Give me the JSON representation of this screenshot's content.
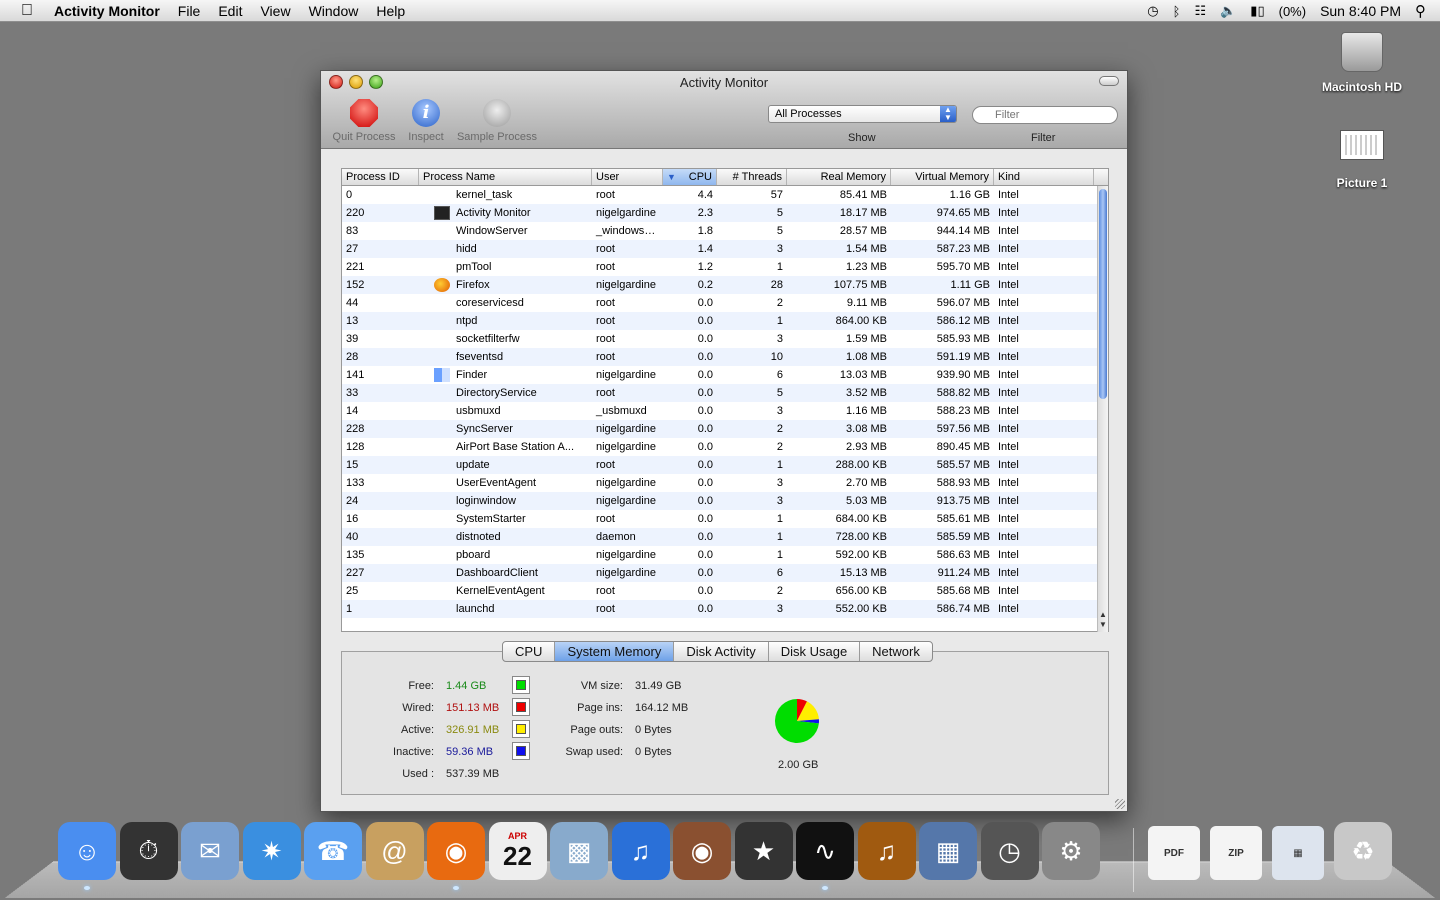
{
  "menubar": {
    "app_name": "Activity Monitor",
    "menus": [
      "File",
      "Edit",
      "View",
      "Window",
      "Help"
    ],
    "battery": "(0%)",
    "clock": "Sun 8:40 PM"
  },
  "desktop": {
    "icons": [
      {
        "label": "Macintosh HD"
      },
      {
        "label": "Picture 1"
      }
    ]
  },
  "window": {
    "title": "Activity Monitor",
    "toolbar": {
      "quit_label": "Quit Process",
      "inspect_label": "Inspect",
      "sample_label": "Sample Process",
      "inspect_glyph": "i",
      "show_value": "All Processes",
      "show_label": "Show",
      "filter_placeholder": "Filter",
      "filter_label": "Filter"
    }
  },
  "table": {
    "columns": {
      "pid": "Process ID",
      "name": "Process Name",
      "user": "User",
      "cpu": "CPU",
      "threads": "# Threads",
      "real": "Real Memory",
      "virtual": "Virtual Memory",
      "kind": "Kind"
    },
    "sorted_column": "cpu",
    "sort_direction": "descending",
    "rows": [
      {
        "pid": "0",
        "icon": "none",
        "name": "kernel_task",
        "user": "root",
        "cpu": "4.4",
        "threads": "57",
        "real": "85.41 MB",
        "virtual": "1.16 GB",
        "kind": "Intel"
      },
      {
        "pid": "220",
        "icon": "activity-monitor-icon",
        "name": "Activity Monitor",
        "user": "nigelgardine",
        "cpu": "2.3",
        "threads": "5",
        "real": "18.17 MB",
        "virtual": "974.65 MB",
        "kind": "Intel"
      },
      {
        "pid": "83",
        "icon": "none",
        "name": "WindowServer",
        "user": "_windowserv",
        "cpu": "1.8",
        "threads": "5",
        "real": "28.57 MB",
        "virtual": "944.14 MB",
        "kind": "Intel"
      },
      {
        "pid": "27",
        "icon": "none",
        "name": "hidd",
        "user": "root",
        "cpu": "1.4",
        "threads": "3",
        "real": "1.54 MB",
        "virtual": "587.23 MB",
        "kind": "Intel"
      },
      {
        "pid": "221",
        "icon": "none",
        "name": "pmTool",
        "user": "root",
        "cpu": "1.2",
        "threads": "1",
        "real": "1.23 MB",
        "virtual": "595.70 MB",
        "kind": "Intel"
      },
      {
        "pid": "152",
        "icon": "firefox-icon",
        "name": "Firefox",
        "user": "nigelgardine",
        "cpu": "0.2",
        "threads": "28",
        "real": "107.75 MB",
        "virtual": "1.11 GB",
        "kind": "Intel"
      },
      {
        "pid": "44",
        "icon": "none",
        "name": "coreservicesd",
        "user": "root",
        "cpu": "0.0",
        "threads": "2",
        "real": "9.11 MB",
        "virtual": "596.07 MB",
        "kind": "Intel"
      },
      {
        "pid": "13",
        "icon": "none",
        "name": "ntpd",
        "user": "root",
        "cpu": "0.0",
        "threads": "1",
        "real": "864.00 KB",
        "virtual": "586.12 MB",
        "kind": "Intel"
      },
      {
        "pid": "39",
        "icon": "none",
        "name": "socketfilterfw",
        "user": "root",
        "cpu": "0.0",
        "threads": "3",
        "real": "1.59 MB",
        "virtual": "585.93 MB",
        "kind": "Intel"
      },
      {
        "pid": "28",
        "icon": "none",
        "name": "fseventsd",
        "user": "root",
        "cpu": "0.0",
        "threads": "10",
        "real": "1.08 MB",
        "virtual": "591.19 MB",
        "kind": "Intel"
      },
      {
        "pid": "141",
        "icon": "finder-icon",
        "name": "Finder",
        "user": "nigelgardine",
        "cpu": "0.0",
        "threads": "6",
        "real": "13.03 MB",
        "virtual": "939.90 MB",
        "kind": "Intel"
      },
      {
        "pid": "33",
        "icon": "none",
        "name": "DirectoryService",
        "user": "root",
        "cpu": "0.0",
        "threads": "5",
        "real": "3.52 MB",
        "virtual": "588.82 MB",
        "kind": "Intel"
      },
      {
        "pid": "14",
        "icon": "none",
        "name": "usbmuxd",
        "user": "_usbmuxd",
        "cpu": "0.0",
        "threads": "3",
        "real": "1.16 MB",
        "virtual": "588.23 MB",
        "kind": "Intel"
      },
      {
        "pid": "228",
        "icon": "none",
        "name": "SyncServer",
        "user": "nigelgardine",
        "cpu": "0.0",
        "threads": "2",
        "real": "3.08 MB",
        "virtual": "597.56 MB",
        "kind": "Intel"
      },
      {
        "pid": "128",
        "icon": "none",
        "name": "AirPort Base Station A...",
        "user": "nigelgardine",
        "cpu": "0.0",
        "threads": "2",
        "real": "2.93 MB",
        "virtual": "890.45 MB",
        "kind": "Intel"
      },
      {
        "pid": "15",
        "icon": "none",
        "name": "update",
        "user": "root",
        "cpu": "0.0",
        "threads": "1",
        "real": "288.00 KB",
        "virtual": "585.57 MB",
        "kind": "Intel"
      },
      {
        "pid": "133",
        "icon": "none",
        "name": "UserEventAgent",
        "user": "nigelgardine",
        "cpu": "0.0",
        "threads": "3",
        "real": "2.70 MB",
        "virtual": "588.93 MB",
        "kind": "Intel"
      },
      {
        "pid": "24",
        "icon": "none",
        "name": "loginwindow",
        "user": "nigelgardine",
        "cpu": "0.0",
        "threads": "3",
        "real": "5.03 MB",
        "virtual": "913.75 MB",
        "kind": "Intel"
      },
      {
        "pid": "16",
        "icon": "none",
        "name": "SystemStarter",
        "user": "root",
        "cpu": "0.0",
        "threads": "1",
        "real": "684.00 KB",
        "virtual": "585.61 MB",
        "kind": "Intel"
      },
      {
        "pid": "40",
        "icon": "none",
        "name": "distnoted",
        "user": "daemon",
        "cpu": "0.0",
        "threads": "1",
        "real": "728.00 KB",
        "virtual": "585.59 MB",
        "kind": "Intel"
      },
      {
        "pid": "135",
        "icon": "none",
        "name": "pboard",
        "user": "nigelgardine",
        "cpu": "0.0",
        "threads": "1",
        "real": "592.00 KB",
        "virtual": "586.63 MB",
        "kind": "Intel"
      },
      {
        "pid": "227",
        "icon": "none",
        "name": "DashboardClient",
        "user": "nigelgardine",
        "cpu": "0.0",
        "threads": "6",
        "real": "15.13 MB",
        "virtual": "911.24 MB",
        "kind": "Intel"
      },
      {
        "pid": "25",
        "icon": "none",
        "name": "KernelEventAgent",
        "user": "root",
        "cpu": "0.0",
        "threads": "2",
        "real": "656.00 KB",
        "virtual": "585.68 MB",
        "kind": "Intel"
      },
      {
        "pid": "1",
        "icon": "none",
        "name": "launchd",
        "user": "root",
        "cpu": "0.0",
        "threads": "3",
        "real": "552.00 KB",
        "virtual": "586.74 MB",
        "kind": "Intel"
      }
    ]
  },
  "tabs": {
    "items": [
      "CPU",
      "System Memory",
      "Disk Activity",
      "Disk Usage",
      "Network"
    ],
    "active": "System Memory"
  },
  "memory": {
    "free_label": "Free:",
    "free": "1.44 GB",
    "free_color": "#1a8a1a",
    "free_swatch": "#00dd00",
    "wired_label": "Wired:",
    "wired": "151.13 MB",
    "wired_color": "#b01010",
    "wired_swatch": "#ee0000",
    "active_label": "Active:",
    "active": "326.91 MB",
    "active_color": "#8a8a10",
    "active_swatch": "#ffee00",
    "inactive_label": "Inactive:",
    "inactive": "59.36 MB",
    "inactive_color": "#1a1a9a",
    "inactive_swatch": "#1010ee",
    "used_label": "Used :",
    "used": "537.39 MB",
    "vm_size_label": "VM size:",
    "vm_size": "31.49 GB",
    "page_ins_label": "Page ins:",
    "page_ins": "164.12 MB",
    "page_outs_label": "Page outs:",
    "page_outs": "0 Bytes",
    "swap_used_label": "Swap used:",
    "swap_used": "0 Bytes",
    "total": "2.00 GB"
  },
  "dock": {
    "items": [
      {
        "icon": "finder-icon",
        "running": true
      },
      {
        "icon": "dashboard-icon",
        "running": false
      },
      {
        "icon": "mail-icon",
        "running": false
      },
      {
        "icon": "safari-icon",
        "running": false
      },
      {
        "icon": "ichat-icon",
        "running": false
      },
      {
        "icon": "address-book-icon",
        "running": false
      },
      {
        "icon": "firefox-icon",
        "running": true
      },
      {
        "icon": "ical-icon",
        "running": false
      },
      {
        "icon": "iphoto-icon",
        "running": false
      },
      {
        "icon": "itunes-icon",
        "running": false
      },
      {
        "icon": "photo-booth-icon",
        "running": false
      },
      {
        "icon": "imovie-icon",
        "running": false
      },
      {
        "icon": "activity-monitor-icon",
        "running": true
      },
      {
        "icon": "garageband-icon",
        "running": false
      },
      {
        "icon": "spaces-icon",
        "running": false
      },
      {
        "icon": "time-machine-icon",
        "running": false
      },
      {
        "icon": "system-preferences-icon",
        "running": false
      },
      {
        "icon": "pdf-document-icon",
        "label": "PDF"
      },
      {
        "icon": "zip-archive-icon",
        "label": "ZIP"
      },
      {
        "icon": "downloads-stack-icon"
      },
      {
        "icon": "trash-icon"
      }
    ],
    "calendar_month": "APR",
    "calendar_day": "22"
  }
}
